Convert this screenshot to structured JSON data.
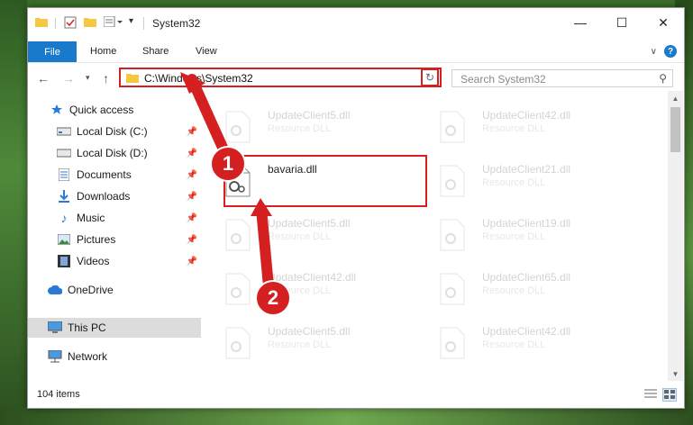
{
  "window": {
    "title": "System32"
  },
  "ribbon": {
    "tabs": [
      "File",
      "Home",
      "Share",
      "View"
    ]
  },
  "address": {
    "path": "C:\\Windows\\System32"
  },
  "search": {
    "placeholder": "Search System32"
  },
  "nav": {
    "quick_access": "Quick access",
    "items": [
      {
        "label": "Local Disk (C:)",
        "icon": "drive-icon",
        "pinned": true
      },
      {
        "label": "Local Disk (D:)",
        "icon": "drive-icon",
        "pinned": true
      },
      {
        "label": "Documents",
        "icon": "documents-icon",
        "pinned": true
      },
      {
        "label": "Downloads",
        "icon": "downloads-icon",
        "pinned": true
      },
      {
        "label": "Music",
        "icon": "music-icon",
        "pinned": true
      },
      {
        "label": "Pictures",
        "icon": "pictures-icon",
        "pinned": true
      },
      {
        "label": "Videos",
        "icon": "videos-icon",
        "pinned": true
      }
    ],
    "onedrive": "OneDrive",
    "this_pc": "This PC",
    "network": "Network"
  },
  "files": {
    "highlighted": {
      "name": "bavaria.dll",
      "type": ""
    },
    "left_column": [
      {
        "name": "UpdateClient5.dll",
        "type": "Resource DLL"
      },
      {
        "name": "UpdateClient5.dll",
        "type": "Resource DLL"
      },
      {
        "name": "UpdateClient42.dll",
        "type": "Resource DLL"
      },
      {
        "name": "UpdateClient5.dll",
        "type": "Resource DLL"
      }
    ],
    "right_column": [
      {
        "name": "UpdateClient42.dll",
        "type": "Resource DLL"
      },
      {
        "name": "UpdateClient21.dll",
        "type": "Resource DLL"
      },
      {
        "name": "UpdateClient19.dll",
        "type": "Resource DLL"
      },
      {
        "name": "UpdateClient65.dll",
        "type": "Resource DLL"
      },
      {
        "name": "UpdateClient42.dll",
        "type": "Resource DLL"
      }
    ]
  },
  "status": {
    "item_count": "104 items"
  },
  "annotations": {
    "marker1": "1",
    "marker2": "2"
  },
  "colors": {
    "accent": "#1979ca",
    "highlight": "#d42020"
  }
}
